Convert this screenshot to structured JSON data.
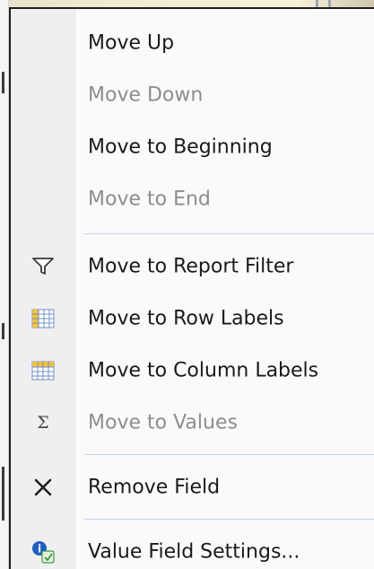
{
  "menu": {
    "items": [
      {
        "label": "Move Up",
        "enabled": true,
        "icon": ""
      },
      {
        "label": "Move Down",
        "enabled": false,
        "icon": ""
      },
      {
        "label": "Move to Beginning",
        "enabled": true,
        "icon": ""
      },
      {
        "label": "Move to End",
        "enabled": false,
        "icon": ""
      },
      {
        "label": "Move to Report Filter",
        "enabled": true,
        "icon": "filter-icon"
      },
      {
        "label": "Move to Row Labels",
        "enabled": true,
        "icon": "row-labels-grid-icon"
      },
      {
        "label": "Move to Column Labels",
        "enabled": true,
        "icon": "column-labels-grid-icon"
      },
      {
        "label": "Move to Values",
        "enabled": false,
        "icon": "sigma-icon"
      },
      {
        "label": "Remove Field",
        "enabled": true,
        "icon": "close-x-icon"
      },
      {
        "label": "Value Field Settings...",
        "enabled": true,
        "icon": "info-settings-icon"
      }
    ]
  },
  "colors": {
    "menu_background": "#fafafa",
    "gutter_background": "#efefef",
    "separator": "#c5d5ea",
    "text_enabled": "#1a1a1a",
    "text_disabled": "#8d8d8d",
    "grid_icon_fill": "#f3c13a",
    "grid_icon_lines": "#7090c8",
    "info_icon_blue": "#1f5fbf",
    "info_icon_green": "#3c9a3c"
  }
}
